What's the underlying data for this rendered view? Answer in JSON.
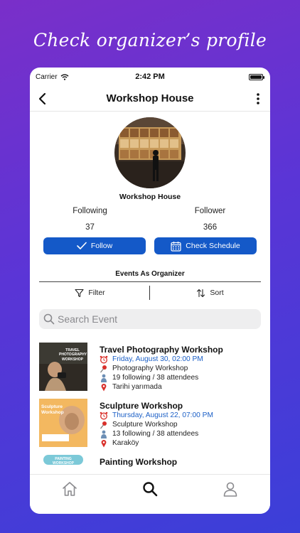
{
  "banner": {
    "text": "Check organizer’s profile"
  },
  "status_bar": {
    "carrier": "Carrier",
    "time": "2:42 PM"
  },
  "nav": {
    "title": "Workshop House"
  },
  "profile": {
    "name": "Workshop House",
    "following_label": "Following",
    "following_count": "37",
    "follower_label": "Follower",
    "follower_count": "366"
  },
  "actions": {
    "follow_label": "Follow",
    "schedule_label": "Check Schedule"
  },
  "events_section": {
    "title": "Events As Organizer",
    "filter_label": "Filter",
    "sort_label": "Sort"
  },
  "search": {
    "placeholder": "Search Event"
  },
  "events": [
    {
      "name": "Travel Photography Workshop",
      "date": "Friday, August 30, 02:00 PM",
      "category": "Photography Workshop",
      "attendees": "19 following / 38 attendees",
      "location": "Tarihi yarımada",
      "thumb_text": "TRAVEL PHOTOGRAPHY WORKSHOP"
    },
    {
      "name": "Sculpture Workshop",
      "date": "Thursday, August 22, 07:00 PM",
      "category": "Sculpture Workshop",
      "attendees": "13 following / 38 attendees",
      "location": "Karaköy",
      "thumb_text": "Sculpture Workshop"
    },
    {
      "name": "Painting Workshop",
      "thumb_text": "PAINTING WORKSHOP"
    }
  ],
  "tabbar": {
    "icons": [
      "home-icon",
      "search-icon",
      "profile-icon"
    ],
    "active": "search-icon"
  },
  "colors": {
    "accent": "#1459c8",
    "date_text": "#1b5fc6",
    "background_gradient": [
      "#7a2fc9",
      "#3b3fd8"
    ]
  }
}
